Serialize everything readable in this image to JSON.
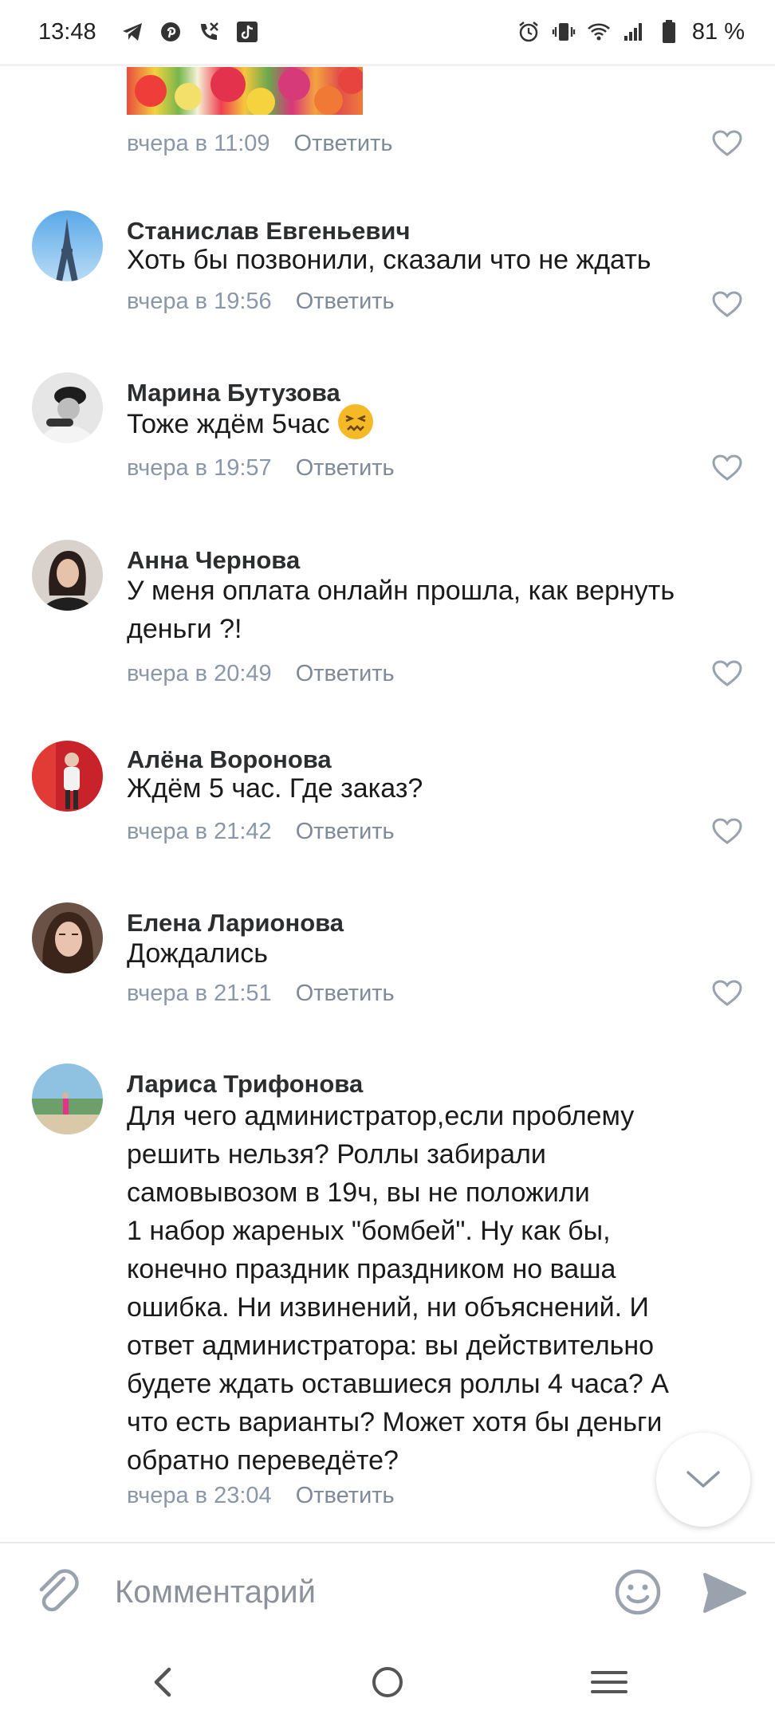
{
  "status_bar": {
    "time": "13:48",
    "left_icons": [
      "telegram-icon",
      "pinterest-icon",
      "missed-call-icon",
      "tiktok-icon"
    ],
    "right_icons": [
      "alarm-icon",
      "vibrate-icon",
      "wifi-icon",
      "signal-icon",
      "battery-icon"
    ],
    "battery": "81 %"
  },
  "first_meta": {
    "time": "вчера в 11:09",
    "reply": "Ответить"
  },
  "comments": [
    {
      "author": "Станислав Евгеньевич",
      "text": "Хоть бы позвонили, сказали что не ждать",
      "time": "вчера в 19:56",
      "reply": "Ответить"
    },
    {
      "author": "Марина Бутузова",
      "text": "Тоже ждём 5час",
      "emoji": "confounded-face-emoji",
      "time": "вчера в 19:57",
      "reply": "Ответить"
    },
    {
      "author": "Анна Чернова",
      "text": "У меня оплата онлайн прошла, как вернуть\nденьги ?!",
      "time": "вчера в 20:49",
      "reply": "Ответить"
    },
    {
      "author": "Алёна Воронова",
      "text": "Ждём 5 час. Где заказ?",
      "time": "вчера в 21:42",
      "reply": "Ответить"
    },
    {
      "author": "Елена Ларионова",
      "text": "Дождались",
      "time": "вчера в 21:51",
      "reply": "Ответить"
    },
    {
      "author": "Лариса Трифонова",
      "text": "Для чего администратор,если проблему\nрешить нельзя? Роллы забирали\nсамовывозом в 19ч, вы не положили\n1 набор жареных \"бомбей\". Ну как бы,\nконечно праздник праздником но ваша\nошибка. Ни извинений, ни объяснений. И\nответ администратора: вы действительно\nбудете ждать оставшиеся роллы 4 часа? А\nчто есть варианты? Может хотя бы деньги\nобратно переведёте?",
      "time": "вчера в 23:04",
      "reply": "Ответить"
    }
  ],
  "composer": {
    "placeholder": "Комментарий",
    "attach_icon": "paperclip-icon",
    "emoji_icon": "smile-icon",
    "send_icon": "send-icon"
  },
  "colors": {
    "meta": "#8a97a8",
    "author": "#2c2d2e",
    "icon": "#99a2ad"
  }
}
